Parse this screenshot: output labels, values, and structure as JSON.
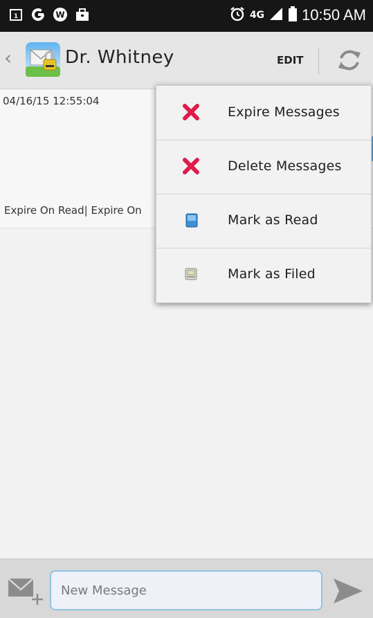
{
  "status_bar": {
    "time": "10:50 AM",
    "network": "4G",
    "icons": [
      "calendar-icon",
      "google-icon",
      "wordpress-icon",
      "briefcase-icon",
      "alarm-icon",
      "network-4g-icon",
      "signal-icon",
      "battery-icon"
    ]
  },
  "header": {
    "contact_name": "Dr. Whitney",
    "edit_label": "EDIT"
  },
  "message": {
    "date": "04/16/15 12:55:04",
    "status": "Expire On Read| Expire On"
  },
  "menu": {
    "items": [
      {
        "label": "Expire Messages",
        "icon": "red-x-icon"
      },
      {
        "label": "Delete Messages",
        "icon": "red-x-icon"
      },
      {
        "label": "Mark as Read",
        "icon": "book-blue-icon"
      },
      {
        "label": "Mark as Filed",
        "icon": "inbox-file-icon"
      }
    ]
  },
  "compose": {
    "placeholder": "New Message"
  },
  "colors": {
    "status_bar": "#161616",
    "action_bar": "#e6e6e6",
    "red_x": "#e01b4b",
    "input_border": "#8fc3e6"
  }
}
